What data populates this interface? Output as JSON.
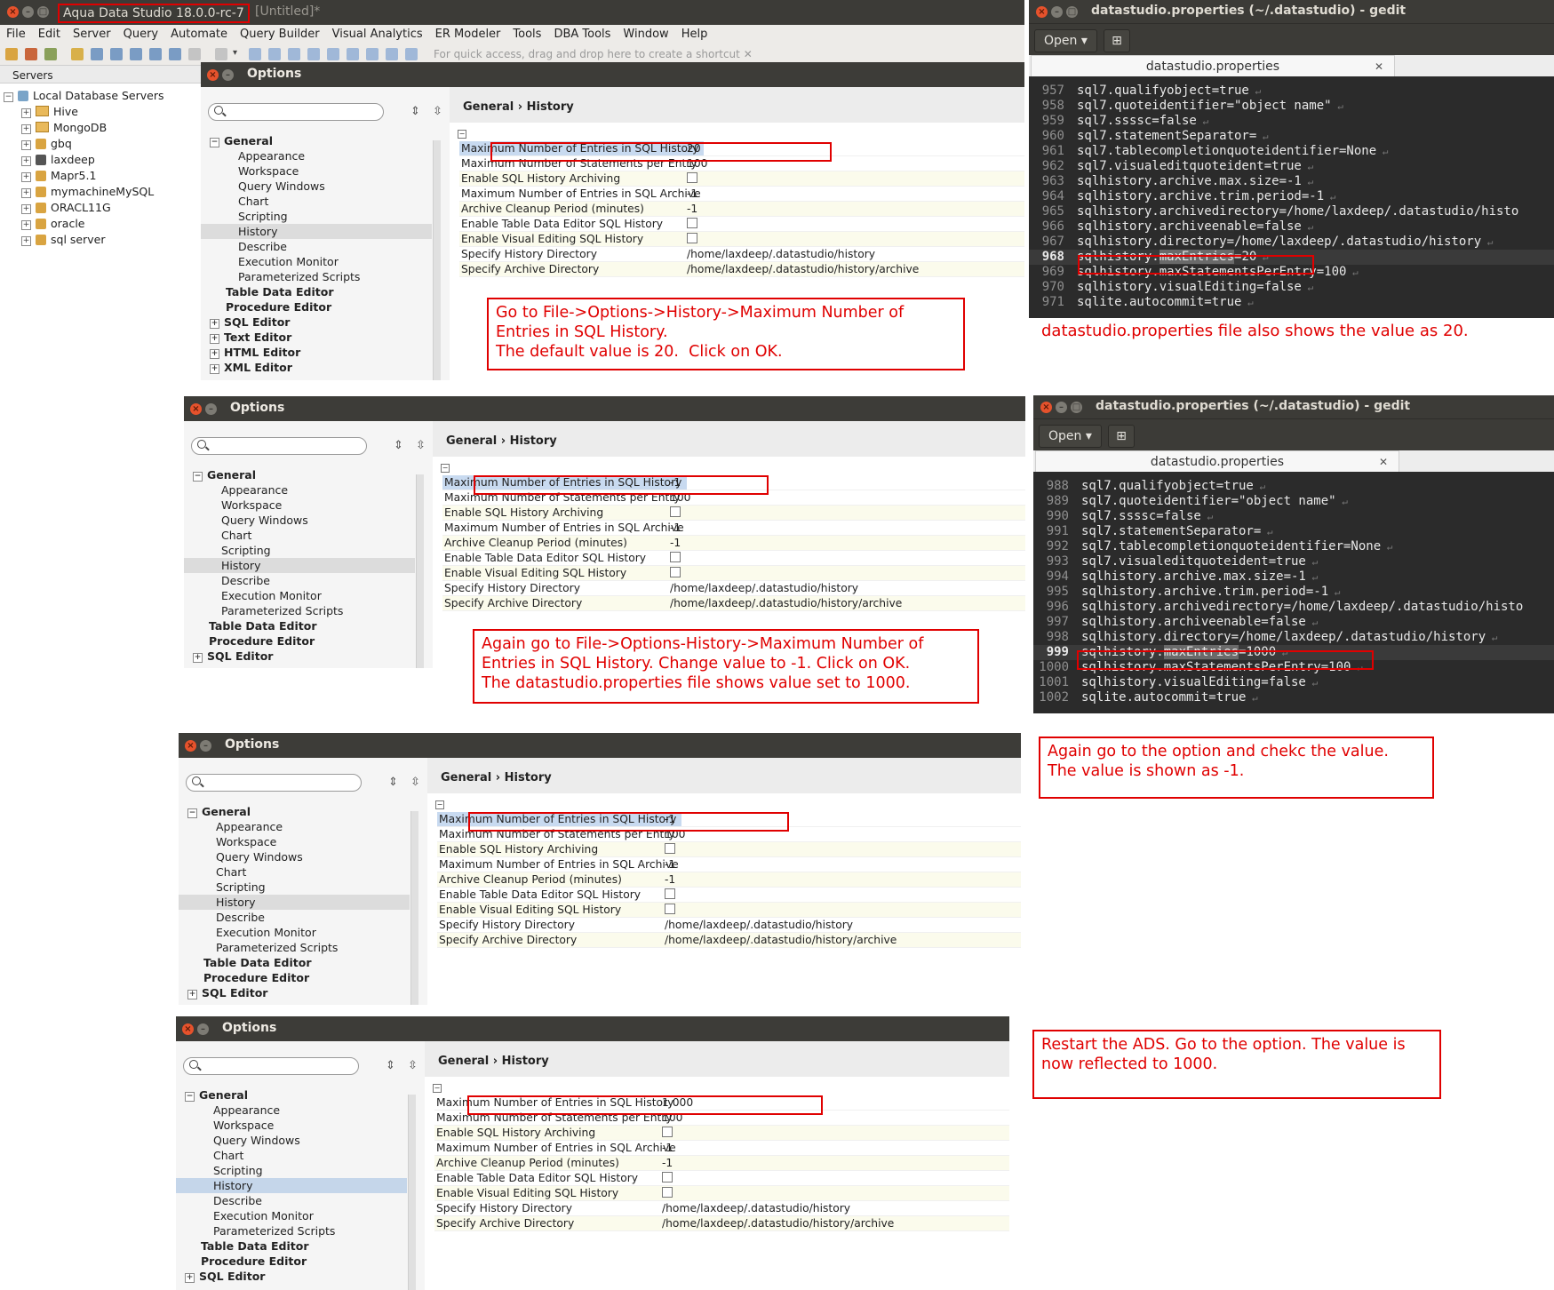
{
  "ads": {
    "title": "Aqua Data Studio 18.0.0-rc-7",
    "title_suffix": "[Untitled]*",
    "menu": [
      "File",
      "Edit",
      "Server",
      "Query",
      "Automate",
      "Query Builder",
      "Visual Analytics",
      "ER Modeler",
      "Tools",
      "DBA Tools",
      "Window",
      "Help"
    ],
    "toolbar_hint": "For quick access, drag and drop here to create a shortcut",
    "servers_tab": "Servers",
    "servers": [
      "Local Database Servers",
      "Hive",
      "MongoDB",
      "gbq",
      "laxdeep",
      "Mapr5.1",
      "mymachineMySQL",
      "ORACL11G",
      "oracle",
      "sql server"
    ]
  },
  "dialog_title": "Options",
  "tree": {
    "general": "General",
    "children": [
      "Appearance",
      "Workspace",
      "Query Windows",
      "Chart",
      "Scripting",
      "History",
      "Describe",
      "Execution Monitor",
      "Parameterized Scripts"
    ],
    "after": [
      "Table Data Editor",
      "Procedure Editor"
    ],
    "collapsed": [
      "SQL Editor",
      "Text Editor",
      "HTML Editor",
      "XML Editor"
    ]
  },
  "breadcrumb": {
    "a": "General",
    "sep": "›",
    "b": "History"
  },
  "props": {
    "keys": [
      "Maximum Number of Entries in SQL History",
      "Maximum Number of Statements per Entry",
      "Enable SQL History Archiving",
      "Maximum Number of Entries in SQL Archive",
      "Archive Cleanup Period (minutes)",
      "Enable Table Data Editor SQL History",
      "Enable Visual Editing SQL History",
      "Specify History Directory",
      "Specify Archive Directory"
    ],
    "statements": "100",
    "archive_entries": "-1",
    "cleanup": "-1",
    "history_dir": "/home/laxdeep/.datastudio/history",
    "archive_dir": "/home/laxdeep/.datastudio/history/archive"
  },
  "panels": [
    {
      "max_entries": "20"
    },
    {
      "max_entries": "-1"
    },
    {
      "max_entries": "-1"
    },
    {
      "max_entries": "1,000"
    }
  ],
  "gedit": {
    "title": "datastudio.properties (~/.datastudio) - gedit",
    "open": "Open",
    "tab": "datastudio.properties",
    "file1": {
      "lines": [
        {
          "n": "957",
          "t": "sql7.qualifyobject=true"
        },
        {
          "n": "958",
          "t": "sql7.quoteidentifier=\"object name\""
        },
        {
          "n": "959",
          "t": "sql7.ssssc=false"
        },
        {
          "n": "960",
          "t": "sql7.statementSeparator="
        },
        {
          "n": "961",
          "t": "sql7.tablecompletionquoteidentifier=None"
        },
        {
          "n": "962",
          "t": "sql7.visualeditquoteident=true"
        },
        {
          "n": "963",
          "t": "sqlhistory.archive.max.size=-1"
        },
        {
          "n": "964",
          "t": "sqlhistory.archive.trim.period=-1"
        },
        {
          "n": "965",
          "t": "sqlhistory.archivedirectory=/home/laxdeep/.datastudio/histo"
        },
        {
          "n": "966",
          "t": "sqlhistory.archiveenable=false"
        },
        {
          "n": "967",
          "t": "sqlhistory.directory=/home/laxdeep/.datastudio/history"
        }
      ],
      "current": {
        "n": "968",
        "pre": "sqlhistory.",
        "hl": "maxEntries",
        "post": "=20"
      },
      "rest": [
        {
          "n": "969",
          "t": "sqlhistory.maxStatementsPerEntry=100"
        },
        {
          "n": "970",
          "t": "sqlhistory.visualEditing=false"
        },
        {
          "n": "971",
          "t": "sqlite.autocommit=true"
        }
      ]
    },
    "file2": {
      "lines": [
        {
          "n": "988",
          "t": "sql7.qualifyobject=true"
        },
        {
          "n": "989",
          "t": "sql7.quoteidentifier=\"object name\""
        },
        {
          "n": "990",
          "t": "sql7.ssssc=false"
        },
        {
          "n": "991",
          "t": "sql7.statementSeparator="
        },
        {
          "n": "992",
          "t": "sql7.tablecompletionquoteidentifier=None"
        },
        {
          "n": "993",
          "t": "sql7.visualeditquoteident=true"
        },
        {
          "n": "994",
          "t": "sqlhistory.archive.max.size=-1"
        },
        {
          "n": "995",
          "t": "sqlhistory.archive.trim.period=-1"
        },
        {
          "n": "996",
          "t": "sqlhistory.archivedirectory=/home/laxdeep/.datastudio/histo"
        },
        {
          "n": "997",
          "t": "sqlhistory.archiveenable=false"
        },
        {
          "n": "998",
          "t": "sqlhistory.directory=/home/laxdeep/.datastudio/history"
        }
      ],
      "current": {
        "n": "999",
        "pre": "sqlhistory.",
        "hl": "maxEntries",
        "post": "=1000"
      },
      "rest": [
        {
          "n": "1000",
          "t": "sqlhistory.maxStatementsPerEntry=100"
        },
        {
          "n": "1001",
          "t": "sqlhistory.visualEditing=false"
        },
        {
          "n": "1002",
          "t": "sqlite.autocommit=true"
        }
      ]
    }
  },
  "notes": {
    "n1": "Go to File->Options->History->Maximum Number of Entries in SQL History.\nThe default value is 20.  Click on OK.",
    "n_gedit1": "datastudio.properties file also shows the value as 20.",
    "n2": "Again go to File->Options-History->Maximum Number of Entries in SQL History. Change value to -1. Click on OK.\nThe datastudio.properties file shows value set to 1000.",
    "n3": "Again go to the option and chekc the value.\nThe value is shown as -1.",
    "n4": "Restart the ADS. Go to the option. The value is now reflected to 1000."
  }
}
